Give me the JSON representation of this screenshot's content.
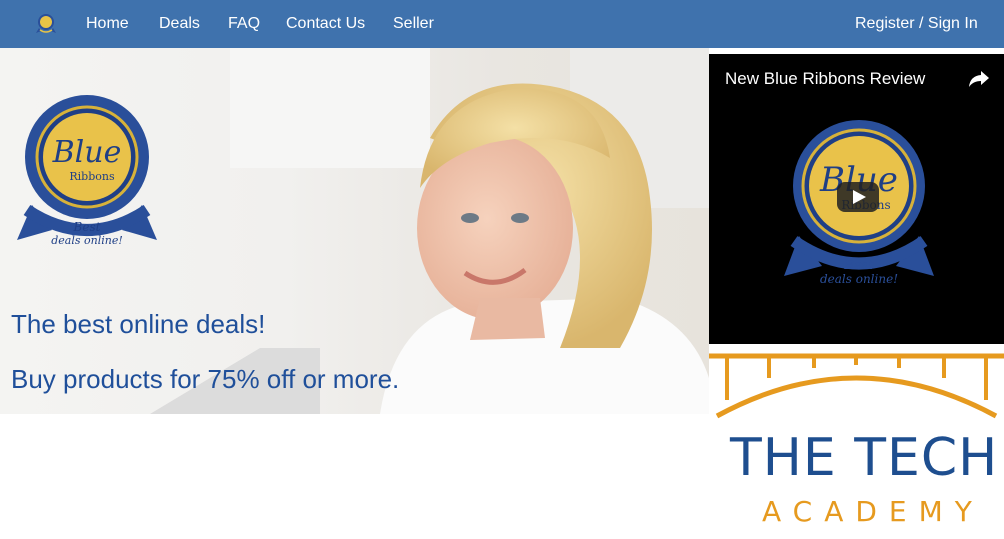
{
  "nav": {
    "logo_icon": "blue-ribbon-logo-icon",
    "items": [
      {
        "label": "Home"
      },
      {
        "label": "Deals"
      },
      {
        "label": "FAQ"
      },
      {
        "label": "Contact Us"
      },
      {
        "label": "Seller"
      }
    ],
    "auth_label": "Register / Sign In",
    "background": "#3f72ad"
  },
  "hero": {
    "badge": {
      "line1": "Blue",
      "line2": "Ribbons",
      "line3": "Best",
      "line4": "deals online!"
    },
    "headline": "The best online deals!",
    "subheadline": "Buy products for 75% off or more.",
    "text_color": "#1f4f9a"
  },
  "video": {
    "title": "New Blue Ribbons Review",
    "share_icon": "share-arrow-icon",
    "play_icon": "play-icon",
    "badge": {
      "line1": "Blue",
      "line2": "Ribbons",
      "line3": "Best",
      "line4": "deals online!"
    }
  },
  "ad": {
    "title": "THE TECH",
    "subtitle": "ACADEMY",
    "title_color": "#1e4e8f",
    "accent_color": "#e69a1f"
  }
}
